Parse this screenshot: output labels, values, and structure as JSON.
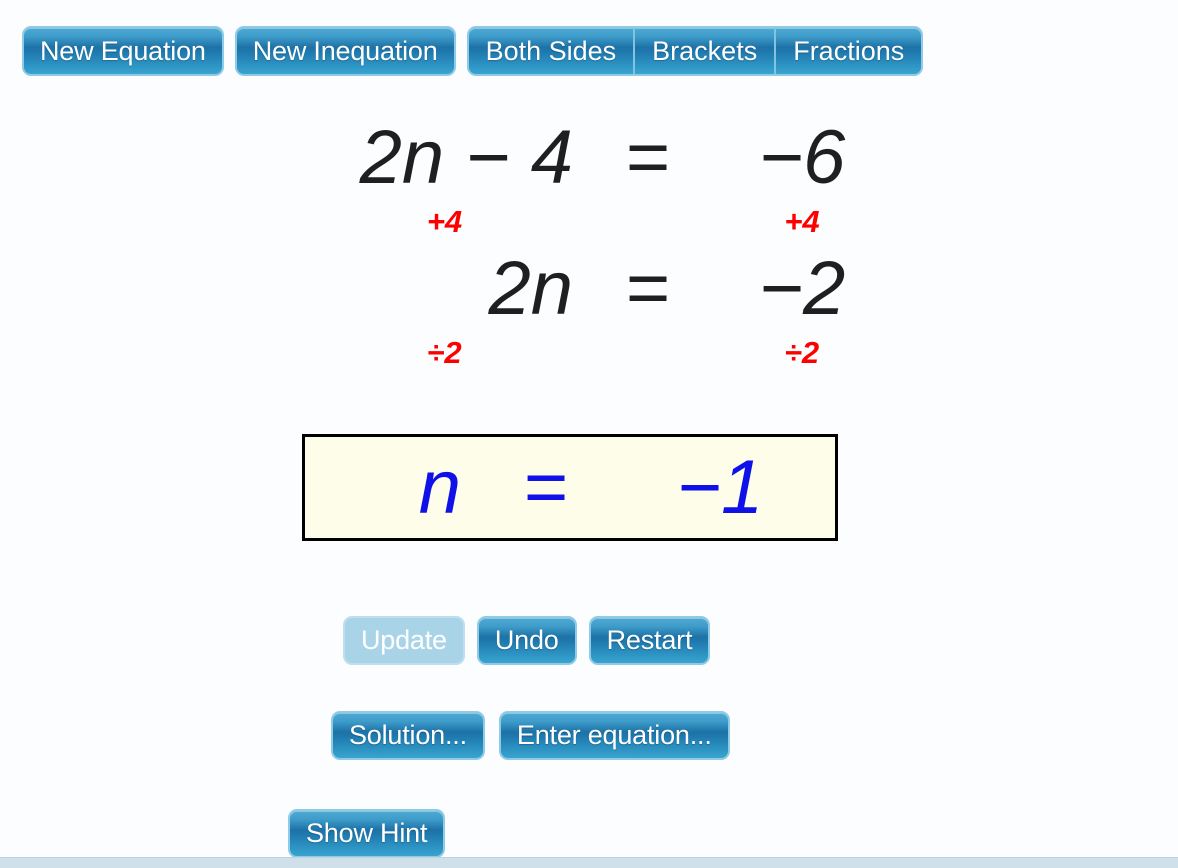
{
  "toolbar": {
    "buttons": [
      {
        "label": "New Equation"
      },
      {
        "label": "New Inequation"
      }
    ],
    "segmented": [
      {
        "label": "Both Sides"
      },
      {
        "label": "Brackets"
      },
      {
        "label": "Fractions"
      }
    ]
  },
  "worksheet": {
    "steps": [
      {
        "lhs": "2n − 4",
        "relation": "=",
        "rhs": "−6",
        "op_lhs": "+4",
        "op_rhs": "+4"
      },
      {
        "lhs": "2n",
        "relation": "=",
        "rhs": "−2",
        "op_lhs": "÷2",
        "op_rhs": "÷2"
      }
    ],
    "answer": {
      "lhs": "n",
      "relation": "=",
      "rhs": "−1"
    }
  },
  "actions": {
    "primary": [
      {
        "label": "Update",
        "disabled": true
      },
      {
        "label": "Undo",
        "disabled": false
      },
      {
        "label": "Restart",
        "disabled": false
      }
    ],
    "secondary": [
      {
        "label": "Solution..."
      },
      {
        "label": "Enter equation..."
      }
    ],
    "hint": {
      "label": "Show Hint"
    }
  },
  "colors": {
    "button_blue_top": "#4fa9d2",
    "button_blue_mid": "#1d72a6",
    "button_border": "#8fcbe6",
    "button_disabled": "#a9d4e8",
    "equation_text": "#1f1f1f",
    "operation_red": "#fe0000",
    "answer_text_blue": "#1010e8",
    "answer_box_bg": "#fdfde9",
    "page_bg": "#fcfdfe",
    "bottom_strip": "#cfe0ea"
  }
}
